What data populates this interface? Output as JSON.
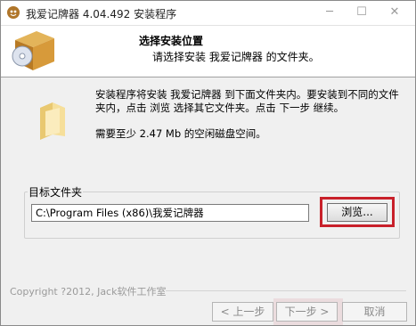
{
  "window": {
    "title": "我爱记牌器 4.04.492 安装程序",
    "controls": {
      "minimize": "─",
      "maximize": "☐",
      "close": "✕"
    }
  },
  "header": {
    "title": "选择安装位置",
    "subtitle": "请选择安装 我爱记牌器 的文件夹。"
  },
  "content": {
    "description_line1": "安装程序将安装 我爱记牌器 到下面文件夹内。要安装到不同的文件",
    "description_line2": "夹内，点击 浏览 选择其它文件夹。点击 下一步 继续。",
    "space_required": "需要至少 2.47 Mb 的空闲磁盘空间。"
  },
  "destination": {
    "group_label": "目标文件夹",
    "path_value": "C:\\Program Files (x86)\\我爱记牌器",
    "browse_label": "浏览..."
  },
  "footer": {
    "copyright": "Copyright ?2012, Jack软件工作室",
    "back_label": "< 上一步",
    "next_label": "下一步 >",
    "cancel_label": "取消"
  },
  "colors": {
    "highlight_border": "#c8202a",
    "window_bg": "#f0f0f0",
    "header_bg": "#ffffff"
  }
}
